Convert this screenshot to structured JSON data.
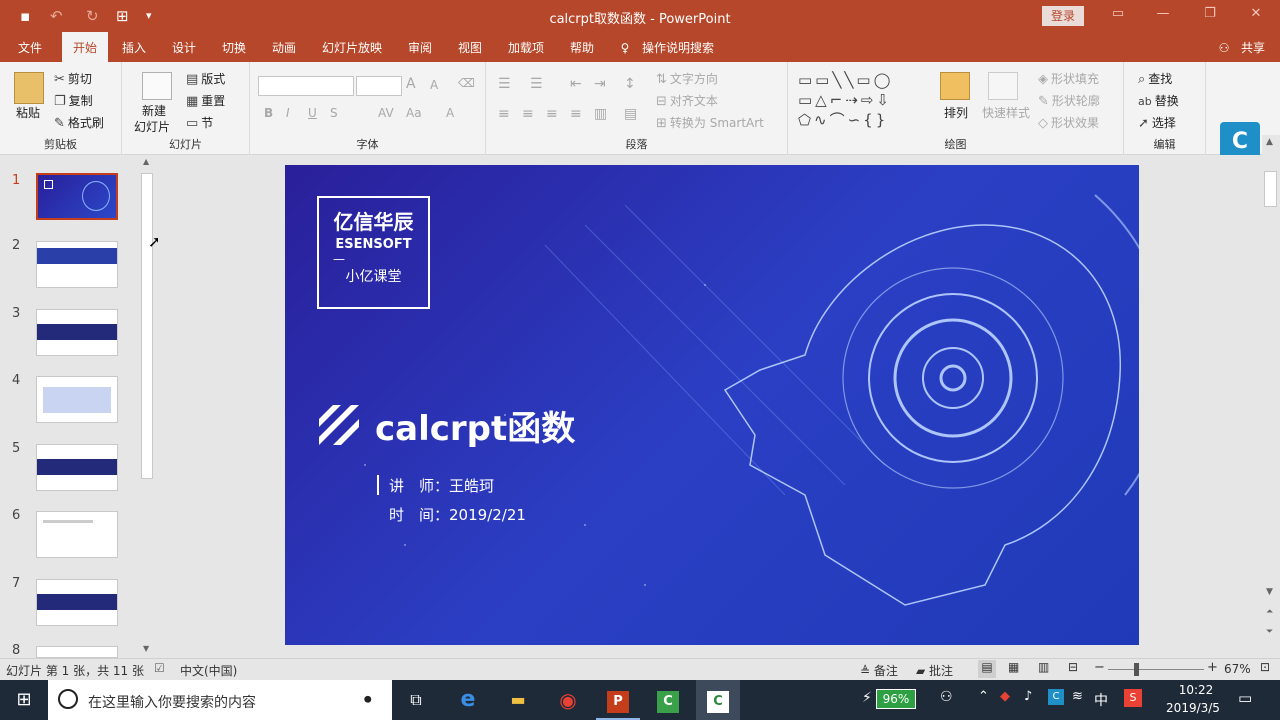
{
  "window": {
    "title": "calcrpt取数函数  -  PowerPoint",
    "login": "登录",
    "share": "共享"
  },
  "tabs": [
    "文件",
    "开始",
    "插入",
    "设计",
    "切换",
    "动画",
    "幻灯片放映",
    "审阅",
    "视图",
    "加载项",
    "帮助",
    "操作说明搜索"
  ],
  "ribbon": {
    "clipboard": {
      "label": "剪贴板",
      "paste": "粘贴",
      "cut": "剪切",
      "copy": "复制",
      "format_painter": "格式刷"
    },
    "slides": {
      "label": "幻灯片",
      "new_slide_1": "新建",
      "new_slide_2": "幻灯片",
      "layout": "版式",
      "reset": "重置",
      "section": "节"
    },
    "font": {
      "label": "字体",
      "bold": "B",
      "italic": "I",
      "underline": "U",
      "strike": "S",
      "spacing": "AV",
      "case": "Aa",
      "color": "A",
      "grow": "A",
      "shrink": "A"
    },
    "paragraph": {
      "label": "段落",
      "text_direction": "文字方向",
      "align_text": "对齐文本",
      "smartart": "转换为 SmartArt"
    },
    "drawing": {
      "label": "绘图",
      "arrange": "排列",
      "quick_styles": "快速样式",
      "shape_fill": "形状填充",
      "shape_outline": "形状轮廓",
      "shape_effects": "形状效果"
    },
    "editing": {
      "label": "编辑",
      "find": "查找",
      "replace": "替换",
      "select": "选择"
    }
  },
  "thumbnails": [
    "1",
    "2",
    "3",
    "4",
    "5",
    "6",
    "7",
    "8"
  ],
  "slide": {
    "logo_cn": "亿信华辰",
    "logo_en": "ESENSOFT",
    "logo_dash": "—",
    "logo_sub": "小亿课堂",
    "title": "calcrpt函数",
    "lecturer_label": "讲　师：",
    "lecturer": "王皓珂",
    "date_label": "时　间：",
    "date": "2019/2/21"
  },
  "status": {
    "slide_info": "幻灯片 第 1 张，共 11 张",
    "language": "中文(中国)",
    "notes": "备注",
    "comments": "批注",
    "zoom": "67%"
  },
  "taskbar": {
    "search_placeholder": "在这里输入你要搜索的内容",
    "battery": "96%",
    "ime": "中",
    "time": "10:22",
    "date": "2019/3/5"
  }
}
